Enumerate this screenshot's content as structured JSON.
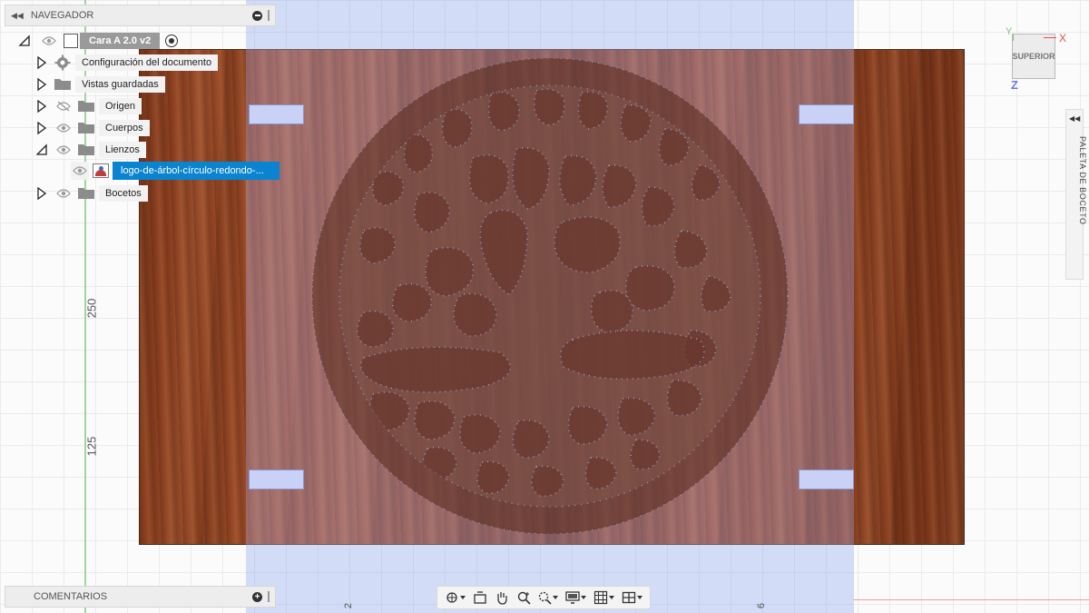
{
  "navigator": {
    "title": "NAVEGADOR",
    "root_label": "Cara A 2.0 v2",
    "items": [
      {
        "label": "Configuración del documento",
        "icon": "gear-icon"
      },
      {
        "label": "Vistas guardadas",
        "icon": "folder-icon"
      },
      {
        "label": "Origen",
        "icon": "folder-icon",
        "visible": false
      },
      {
        "label": "Cuerpos",
        "icon": "folder-icon",
        "visible": true
      },
      {
        "label": "Lienzos",
        "icon": "folder-icon",
        "visible": true,
        "expanded": true
      },
      {
        "label": "Bocetos",
        "icon": "folder-icon",
        "visible": true
      }
    ],
    "canvas_item": {
      "label": "logo-de-árbol-círculo-redondo-...",
      "selected": true
    }
  },
  "comments": {
    "title": "COMENTARIOS"
  },
  "viewcube": {
    "face": "SUPERIOR",
    "axes": {
      "x": "X",
      "y": "Y",
      "z": "Z"
    }
  },
  "palette": {
    "title": "PALETA DE BOCETO"
  },
  "rulers": {
    "v_250": "250",
    "v_125": "125",
    "h_2": "2",
    "h_6": "6"
  },
  "toolbar": {
    "buttons": [
      "orbit-icon",
      "look-at-icon",
      "pan-icon",
      "zoom-icon",
      "zoom-window-icon",
      "display-settings-icon",
      "grid-icon",
      "viewports-icon"
    ]
  },
  "colors": {
    "selection": "#0a84d0",
    "sketch_region": "#9fb1f0",
    "wood": "#8a3e1f",
    "x_axis": "#e05252",
    "y_axis": "#7cc47c",
    "z_axis": "#6a7de0"
  }
}
